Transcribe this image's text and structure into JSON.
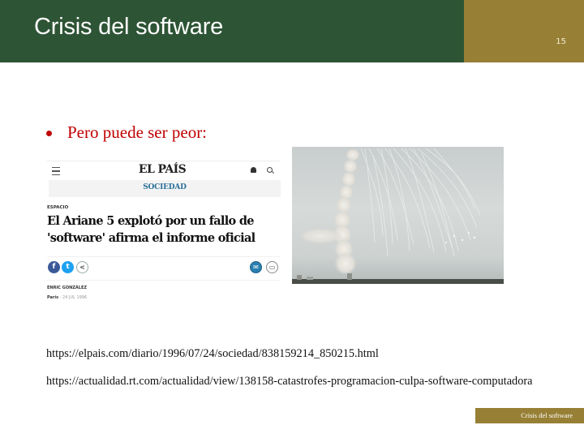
{
  "header": {
    "title": "Crisis del software",
    "slide_number": "15"
  },
  "bullets": [
    {
      "text": "Pero puede ser peor:"
    }
  ],
  "newspaper": {
    "logo": "EL PAÍS",
    "section": "SOCIEDAD",
    "kicker": "ESPACIO",
    "headline": "El Ariane 5 explotó por un fallo de 'software' afirma el informe oficial",
    "author": "ENRIC GONZÁLEZ",
    "place": "París",
    "date": "- 24 JUL 1996",
    "icons": {
      "menu": "menu-icon",
      "user": "user-icon",
      "search": "search-icon",
      "facebook": "f",
      "twitter": "t",
      "share": "<",
      "mail": "✉",
      "print": "▭"
    }
  },
  "photo": {
    "description": "Ariane 5 rocket explosion with smoke trail over launch site"
  },
  "links": [
    "https://elpais.com/diario/1996/07/24/sociedad/838159214_850215.html",
    "https://actualidad.rt.com/actualidad/view/138158-catastrofes-programacion-culpa-software-computadora"
  ],
  "footer": {
    "text": "Crisis del software"
  },
  "colors": {
    "header_green": "#2d5435",
    "header_gold": "#978036",
    "bullet_red": "#c00000"
  }
}
